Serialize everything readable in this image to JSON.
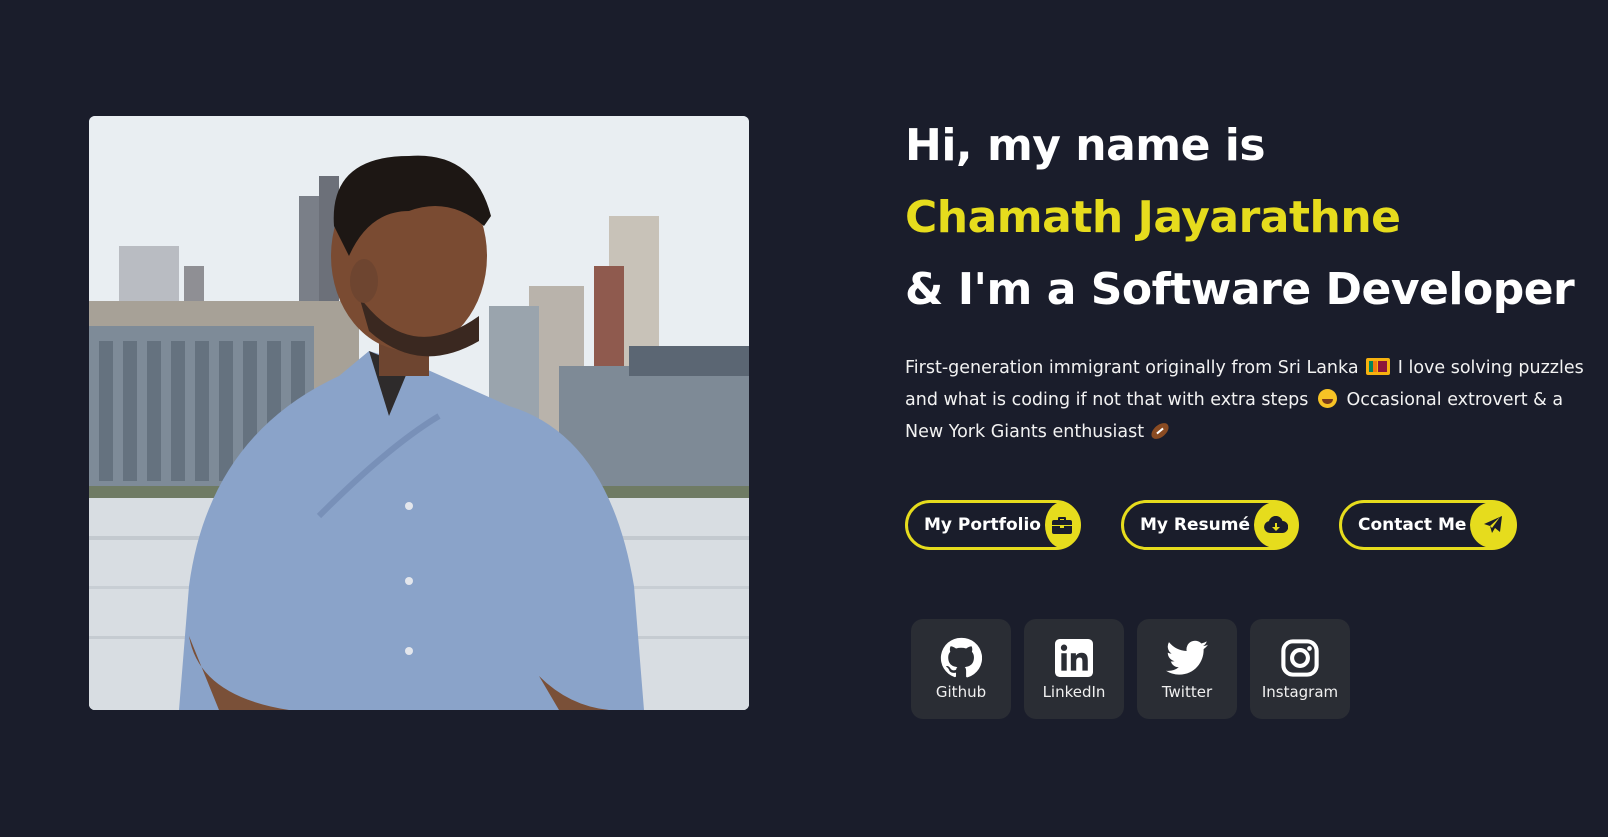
{
  "hero": {
    "greeting": "Hi, my name is",
    "name": "Chamath Jayarathne",
    "role": "& I'm a Software Developer",
    "bio": {
      "part1": "First-generation immigrant originally from Sri Lanka",
      "part2": "I love solving puzzles and what is coding if not that with extra steps",
      "part3": "Occasional extrovert & a New York Giants enthusiast"
    }
  },
  "buttons": [
    {
      "label": "My Portfolio",
      "icon": "briefcase-icon"
    },
    {
      "label": "My Resumé",
      "icon": "cloud-download-icon"
    },
    {
      "label": "Contact Me",
      "icon": "paper-plane-icon"
    }
  ],
  "socials": [
    {
      "label": "Github",
      "icon": "github-icon"
    },
    {
      "label": "LinkedIn",
      "icon": "linkedin-icon"
    },
    {
      "label": "Twitter",
      "icon": "twitter-icon"
    },
    {
      "label": "Instagram",
      "icon": "instagram-icon"
    }
  ],
  "colors": {
    "background": "#1a1d2b",
    "accent": "#e6dc1d",
    "tile": "#2a2d34"
  }
}
